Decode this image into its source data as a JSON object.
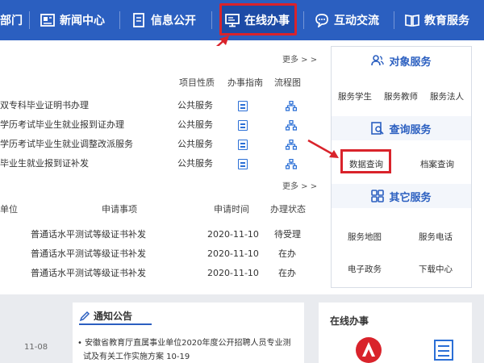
{
  "nav": {
    "items": [
      {
        "label": "部门"
      },
      {
        "label": "新闻中心"
      },
      {
        "label": "信息公开"
      },
      {
        "label": "在线办事"
      },
      {
        "label": "互动交流"
      },
      {
        "label": "教育服务"
      }
    ]
  },
  "services": {
    "more": "更多 > >",
    "headers": {
      "type": "项目性质",
      "guide": "办事指南",
      "flow": "流程图"
    },
    "rows": [
      {
        "name": "双专科毕业证明书办理",
        "type": "公共服务"
      },
      {
        "name": "学历考试毕业生就业报到证办理",
        "type": "公共服务"
      },
      {
        "name": "学历考试毕业生就业调整改派服务",
        "type": "公共服务"
      },
      {
        "name": "毕业生就业报到证补发",
        "type": "公共服务"
      }
    ]
  },
  "apps": {
    "more": "更多 > >",
    "headers": {
      "unit": "单位",
      "item": "申请事项",
      "time": "申请时间",
      "status": "办理状态"
    },
    "rows": [
      {
        "item": "普通话水平测试等级证书补发",
        "time": "2020-11-10",
        "status": "待受理"
      },
      {
        "item": "普通话水平测试等级证书补发",
        "time": "2020-11-10",
        "status": "在办"
      },
      {
        "item": "普通话水平测试等级证书补发",
        "time": "2020-11-10",
        "status": "在办"
      }
    ]
  },
  "sidebar": {
    "object_title": "对象服务",
    "object_links": [
      "服务学生",
      "服务教师",
      "服务法人"
    ],
    "query_title": "查询服务",
    "query_links": [
      "数据查询",
      "档案查询"
    ],
    "other_title": "其它服务",
    "other_links": [
      "服务地图",
      "服务电话",
      "电子政务",
      "下载中心"
    ]
  },
  "bottom": {
    "date": "11-08",
    "notice_title": "通知公告",
    "notice_text_1": "• 安徽省教育厅直属事业单位2020年度公开招聘人员专业测",
    "notice_text_2": "试及有关工作实施方案   10-19",
    "online_title": "在线办事"
  },
  "colors": {
    "nav_bg": "#2b5fc0",
    "highlight": "#d9232b",
    "accent": "#2b6fd6"
  }
}
